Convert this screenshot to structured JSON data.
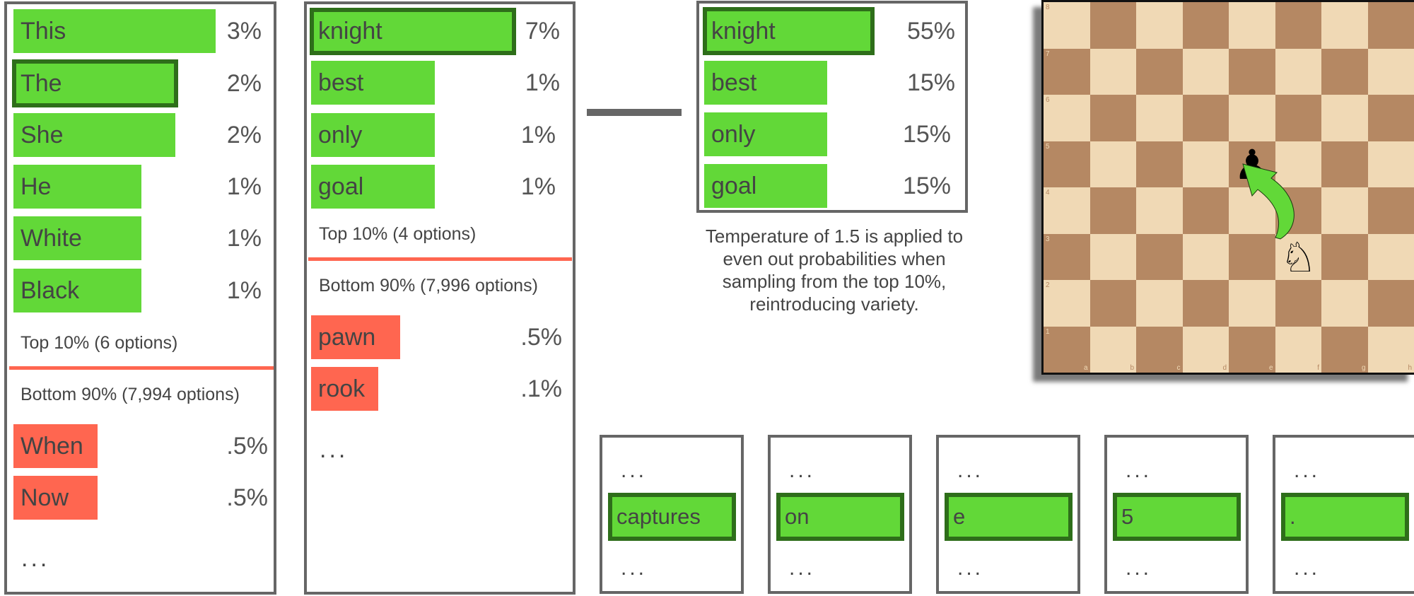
{
  "colors": {
    "top": "#62d838",
    "selected_border": "#2e6e1a",
    "bottom": "#ff6650",
    "frame": "#666666"
  },
  "panel1": {
    "top": [
      {
        "word": "This",
        "pct": "3%"
      },
      {
        "word": "The",
        "pct": "2%",
        "selected": true
      },
      {
        "word": "She",
        "pct": "2%"
      },
      {
        "word": "He",
        "pct": "1%"
      },
      {
        "word": "White",
        "pct": "1%"
      },
      {
        "word": "Black",
        "pct": "1%"
      }
    ],
    "top_label": "Top 10% (6 options)",
    "bottom_label": "Bottom 90% (7,994 options)",
    "bottom": [
      {
        "word": "When",
        "pct": ".5%"
      },
      {
        "word": "Now",
        "pct": ".5%"
      }
    ],
    "ellipsis": "..."
  },
  "panel2": {
    "top": [
      {
        "word": "knight",
        "pct": "7%",
        "selected": true
      },
      {
        "word": "best",
        "pct": "1%"
      },
      {
        "word": "only",
        "pct": "1%"
      },
      {
        "word": "goal",
        "pct": "1%"
      }
    ],
    "top_label": "Top 10% (4 options)",
    "bottom_label": "Bottom 90% (7,996 options)",
    "bottom": [
      {
        "word": "pawn",
        "pct": ".5%"
      },
      {
        "word": "rook",
        "pct": ".1%"
      }
    ],
    "ellipsis": "..."
  },
  "panel3": {
    "top": [
      {
        "word": "knight",
        "pct": "55%",
        "selected": true
      },
      {
        "word": "best",
        "pct": "15%"
      },
      {
        "word": "only",
        "pct": "15%"
      },
      {
        "word": "goal",
        "pct": "15%"
      }
    ],
    "caption": [
      "Temperature of 1.5 is applied to",
      "even out probabilities when",
      "sampling from the top 10%,",
      "reintroducing variety."
    ]
  },
  "tokens": [
    {
      "word": "captures"
    },
    {
      "word": "on"
    },
    {
      "word": "e"
    },
    {
      "word": "5"
    },
    {
      "word": "."
    }
  ],
  "token_ellipsis": "...",
  "board": {
    "ranks": [
      "8",
      "7",
      "6",
      "5",
      "4",
      "3",
      "2",
      "1"
    ],
    "files": [
      "a",
      "b",
      "c",
      "d",
      "e",
      "f",
      "g",
      "h"
    ],
    "pieces": [
      {
        "piece": "black-pawn",
        "glyph": "♟",
        "square": "e5"
      },
      {
        "piece": "white-knight",
        "glyph": "♘",
        "square": "f3"
      }
    ],
    "move_arrow": {
      "from": "f3",
      "to": "e5",
      "color": "#62d838"
    }
  }
}
